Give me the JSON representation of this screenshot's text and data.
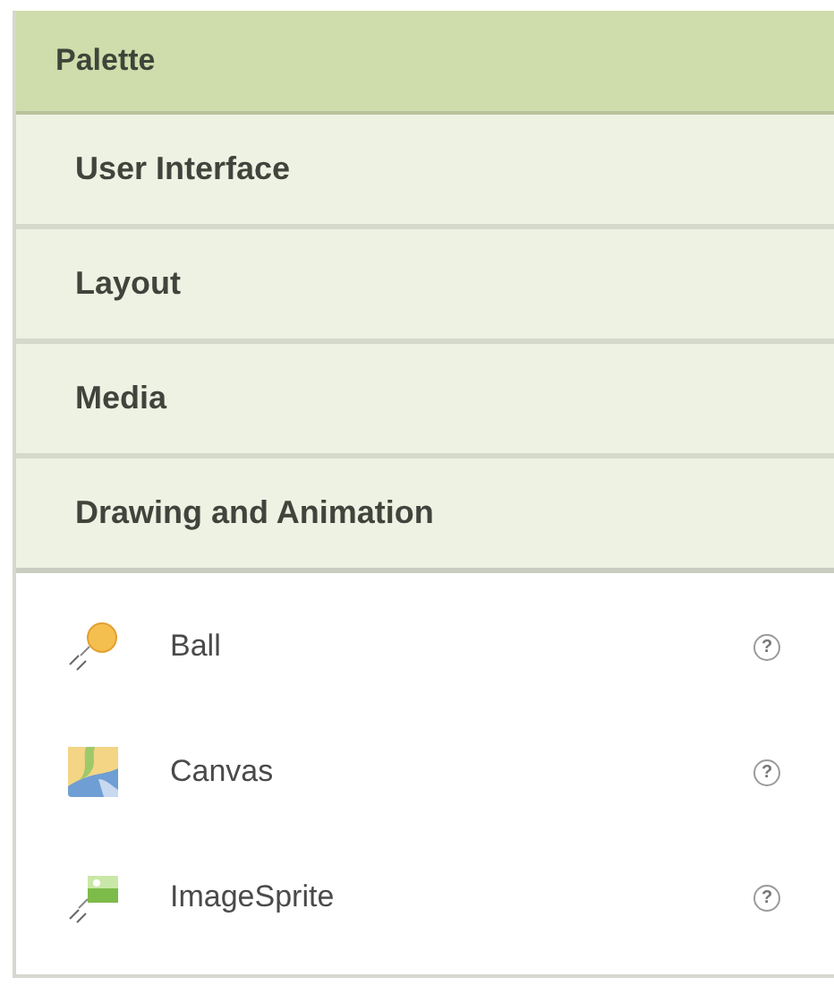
{
  "palette": {
    "title": "Palette",
    "categories": [
      {
        "label": "User Interface",
        "expanded": false
      },
      {
        "label": "Layout",
        "expanded": false
      },
      {
        "label": "Media",
        "expanded": false
      },
      {
        "label": "Drawing and Animation",
        "expanded": true,
        "components": [
          {
            "label": "Ball",
            "help": "?"
          },
          {
            "label": "Canvas",
            "help": "?"
          },
          {
            "label": "ImageSprite",
            "help": "?"
          }
        ]
      }
    ]
  }
}
